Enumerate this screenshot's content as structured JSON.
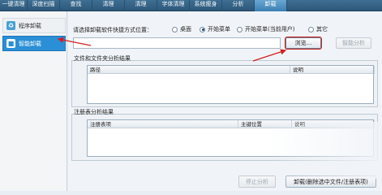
{
  "top_tabs": [
    "一键清理",
    "深度扫描",
    "查找",
    "清理",
    "清理",
    "字体清理",
    "系统瘦身",
    "分析",
    "卸载"
  ],
  "active_top_tab": 8,
  "sidebar": {
    "items": [
      {
        "label": "程序卸载",
        "icon": "recycle-icon"
      },
      {
        "label": "智能卸载",
        "icon": "trash-icon"
      }
    ],
    "active_index": 1
  },
  "shortcut": {
    "prompt": "请选择卸载软件快捷方式位置：",
    "options": [
      "桌面",
      "开始菜单",
      "开始菜单(当前用户)",
      "其它"
    ],
    "selected_index": 1,
    "path_value": "",
    "browse_label": "浏览...",
    "analyze_label": "智能分析"
  },
  "file_results": {
    "title": "文件和文件夹分析结果",
    "columns": [
      "路径",
      "说明"
    ],
    "rows": []
  },
  "registry_results": {
    "title": "注册表分析结果",
    "columns": [
      "注册表项",
      "主键位置",
      "说明"
    ],
    "rows": []
  },
  "footer": {
    "stop_label": "停止分析",
    "uninstall_label": "卸载(删除选中文件/注册表项)"
  },
  "colors": {
    "accent": "#2a8fd6",
    "annotation": "#d02020",
    "topbar": "#2d577a"
  }
}
